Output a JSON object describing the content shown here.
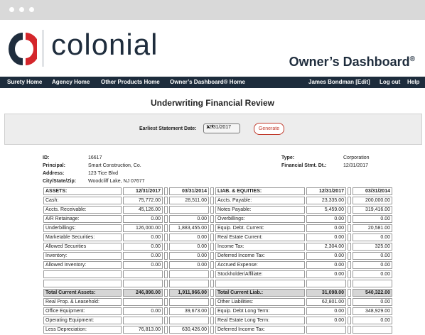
{
  "brand": {
    "name": "colonial",
    "dashboard_title": "Owner’s Dashboard",
    "dashboard_mark": "®"
  },
  "nav": {
    "items": [
      "Surety Home",
      "Agency Home",
      "Other Products Home",
      "Owner’s Dashboard® Home"
    ],
    "user": "James Bondman [Edit]",
    "logout": "Log out",
    "help": "Help"
  },
  "page_title": "Underwriting Financial Review",
  "filter": {
    "label": "Earliest Statement Date:",
    "selected_date": "12/31/2017",
    "button": "Generate"
  },
  "info": {
    "id_label": "ID:",
    "id_value": "16617",
    "principal_label": "Principal:",
    "principal_value": "Smart Construction, Co.",
    "address_label": "Address:",
    "address_value": "123 Tice Blvd",
    "csz_label": "City/State/Zip:",
    "csz_value": "Woodcliff Lake, NJ 07677",
    "type_label": "Type:",
    "type_value": "Corporation",
    "fsd_label": "Financial Stmt. Dt.:",
    "fsd_value": "12/31/2017"
  },
  "table": {
    "headers": {
      "assets": "ASSETS:",
      "liab": "LIAB. & EQUITIES:",
      "d1": "12/31/2017",
      "d2": "03/31/2014"
    },
    "rows": [
      {
        "a": "Cash:",
        "a1": "75,772.00",
        "a2": "28,511.00",
        "l": "Accts. Payable:",
        "l1": "23,335.00",
        "l2": "200,000.00"
      },
      {
        "a": "Accts. Receivable:",
        "a1": "45,126.00",
        "a2": "",
        "l": "Notes Payable:",
        "l1": "5,459.00",
        "l2": "319,416.00"
      },
      {
        "a": "A/R Retainage:",
        "a1": "0.00",
        "a2": "0.00",
        "l": "Overbillings:",
        "l1": "0.00",
        "l2": "0.00"
      },
      {
        "a": "Underbillings:",
        "a1": "126,000.00",
        "a2": "1,883,455.00",
        "l": "Equip. Debt. Current:",
        "l1": "0.00",
        "l2": "20,581.00"
      },
      {
        "a": "Marketable Securities:",
        "a1": "0.00",
        "a2": "0.00",
        "l": "Real Estate Current:",
        "l1": "0.00",
        "l2": "0.00"
      },
      {
        "a": "Allowed Securities",
        "a1": "0.00",
        "a2": "0.00",
        "l": "Income Tax:",
        "l1": "2,304.00",
        "l2": "325.00"
      },
      {
        "a": "Inventory:",
        "a1": "0.00",
        "a2": "0.00",
        "l": "Deferred Income Tax:",
        "l1": "0.00",
        "l2": "0.00"
      },
      {
        "a": "Allowed Inventory:",
        "a1": "0.00",
        "a2": "0.00",
        "l": "Accrued Expense:",
        "l1": "0.00",
        "l2": "0.00"
      },
      {
        "a": "",
        "a1": "",
        "a2": "",
        "l": "Stockholder/Affiliate:",
        "l1": "0.00",
        "l2": "0.00"
      },
      {
        "a": "",
        "a1": "",
        "a2": "",
        "l": "",
        "l1": "",
        "l2": ""
      }
    ],
    "totals": {
      "a": "Total Current Assets:",
      "a1": "246,898.00",
      "a2": "1,911,966.00",
      "l": "Total Current Liab.:",
      "l1": "31,098.00",
      "l2": "540,322.00"
    },
    "rows2": [
      {
        "a": "Real Prop. & Leasehold:",
        "a1": "",
        "a2": "",
        "l": "Other Liabilities:",
        "l1": "62,801.00",
        "l2": "0.00"
      },
      {
        "a": "Office Equipment:",
        "a1": "0.00",
        "a2": "39,673.00",
        "l": "Equip. Debt Long Term:",
        "l1": "0.00",
        "l2": "348,929.00"
      },
      {
        "a": "Operating Equipment:",
        "a1": "",
        "a2": "",
        "l": "Real Estate Long Term:",
        "l1": "0.00",
        "l2": "0.00"
      },
      {
        "a": "Less Depreciation:",
        "a1": "76,813.00",
        "a2": "630,426.00",
        "l": "Deferred Income Tax:",
        "l1": "",
        "l2": ""
      }
    ]
  }
}
